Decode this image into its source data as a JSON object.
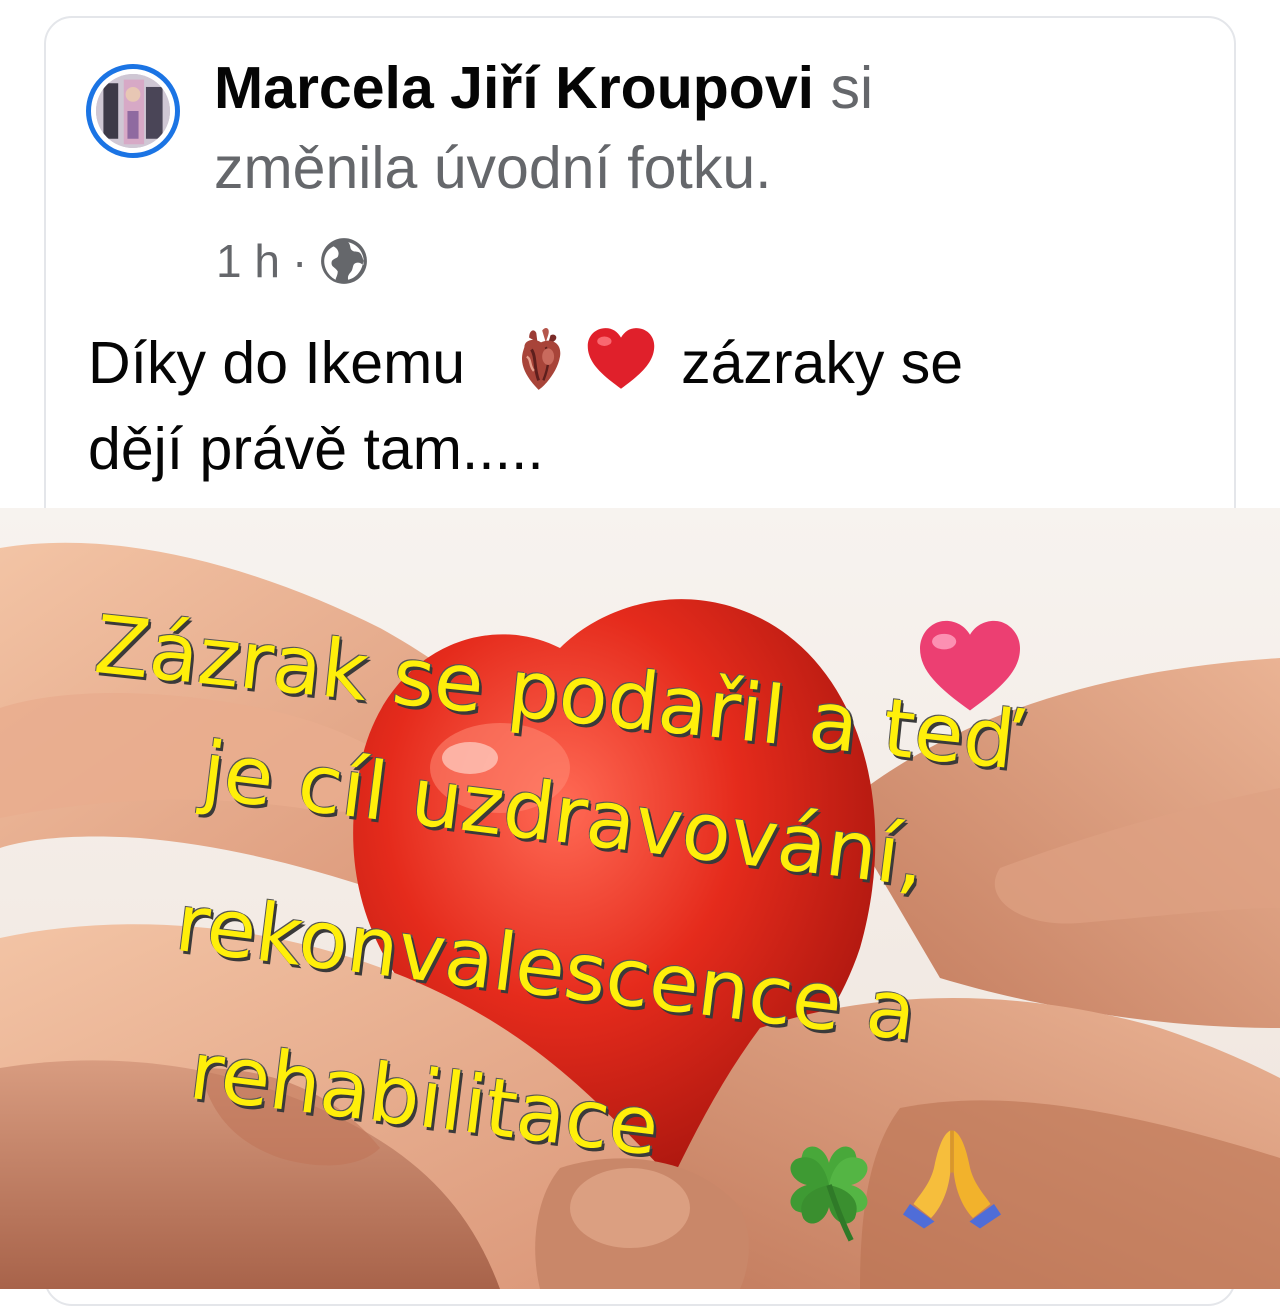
{
  "post": {
    "author": "Marcela Jiří Kroupovi",
    "action_lead": "si",
    "action_rest": "změnila úvodní fotku.",
    "time": "1 h",
    "separator": "·",
    "privacy_icon": "globe-icon",
    "caption_part1": "Díky do Ikemu",
    "caption_emojis": [
      "anatomical-heart",
      "red-heart"
    ],
    "caption_part2": "zázraky se",
    "caption_part3": "dějí právě tam....."
  },
  "photo": {
    "overlay_lines": [
      "Zázrak  se podařil a teď",
      "je cíl uzdravování,",
      "rekonvalescence a",
      "rehabilitace"
    ],
    "overlay_emojis": [
      "pink-heart",
      "four-leaf-clover",
      "folded-hands"
    ],
    "overlay_text_color": "#ffef0a"
  },
  "colors": {
    "avatar_ring": "#1b74e4",
    "secondary_text": "#65676b",
    "primary_text": "#050505",
    "card_border": "#e4e6ea"
  }
}
